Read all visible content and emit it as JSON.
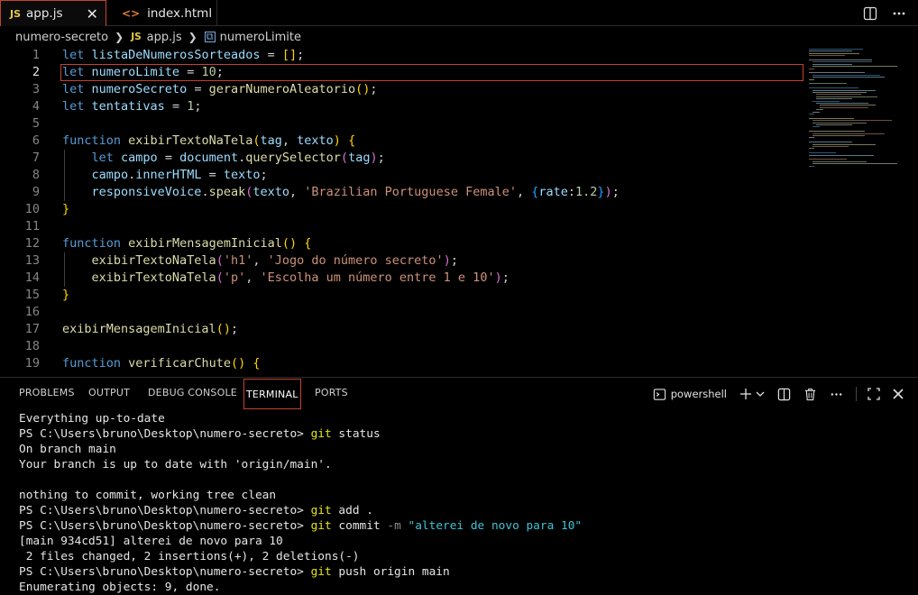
{
  "tabs": [
    {
      "badge": "JS",
      "label": "app.js",
      "close": "✕",
      "active": true
    },
    {
      "badge": "<>",
      "label": "index.html",
      "active": false
    }
  ],
  "breadcrumb": {
    "folder": "numero-secreto",
    "file_badge": "JS",
    "file": "app.js",
    "symbol": "numeroLimite"
  },
  "editor": {
    "current_line": 2,
    "line_numbers": [
      "1",
      "2",
      "3",
      "4",
      "5",
      "6",
      "7",
      "8",
      "9",
      "10",
      "11",
      "12",
      "13",
      "14",
      "15",
      "16",
      "17",
      "18",
      "19"
    ],
    "lines": [
      [
        {
          "t": "let",
          "c": "kw"
        },
        {
          "t": " "
        },
        {
          "t": "listaDeNumerosSorteados",
          "c": "var"
        },
        {
          "t": " = "
        },
        {
          "t": "[]",
          "c": "br1"
        },
        {
          "t": ";"
        }
      ],
      [
        {
          "t": "let",
          "c": "kw"
        },
        {
          "t": " "
        },
        {
          "t": "numeroLimite",
          "c": "var"
        },
        {
          "t": " = "
        },
        {
          "t": "10",
          "c": "num"
        },
        {
          "t": ";"
        }
      ],
      [
        {
          "t": "let",
          "c": "kw"
        },
        {
          "t": " "
        },
        {
          "t": "numeroSecreto",
          "c": "var"
        },
        {
          "t": " = "
        },
        {
          "t": "gerarNumeroAleatorio",
          "c": "fn"
        },
        {
          "t": "()",
          "c": "br1"
        },
        {
          "t": ";"
        }
      ],
      [
        {
          "t": "let",
          "c": "kw"
        },
        {
          "t": " "
        },
        {
          "t": "tentativas",
          "c": "var"
        },
        {
          "t": " = "
        },
        {
          "t": "1",
          "c": "num"
        },
        {
          "t": ";"
        }
      ],
      [],
      [
        {
          "t": "function",
          "c": "kw"
        },
        {
          "t": " "
        },
        {
          "t": "exibirTextoNaTela",
          "c": "fn"
        },
        {
          "t": "(",
          "c": "br1"
        },
        {
          "t": "tag",
          "c": "var"
        },
        {
          "t": ", "
        },
        {
          "t": "texto",
          "c": "var"
        },
        {
          "t": ")",
          "c": "br1"
        },
        {
          "t": " "
        },
        {
          "t": "{",
          "c": "br1"
        }
      ],
      [
        {
          "t": "    "
        },
        {
          "t": "let",
          "c": "kw"
        },
        {
          "t": " "
        },
        {
          "t": "campo",
          "c": "var"
        },
        {
          "t": " = "
        },
        {
          "t": "document",
          "c": "var"
        },
        {
          "t": "."
        },
        {
          "t": "querySelector",
          "c": "fn"
        },
        {
          "t": "(",
          "c": "br2"
        },
        {
          "t": "tag",
          "c": "var"
        },
        {
          "t": ")",
          "c": "br2"
        },
        {
          "t": ";"
        }
      ],
      [
        {
          "t": "    "
        },
        {
          "t": "campo",
          "c": "var"
        },
        {
          "t": "."
        },
        {
          "t": "innerHTML",
          "c": "var"
        },
        {
          "t": " = "
        },
        {
          "t": "texto",
          "c": "var"
        },
        {
          "t": ";"
        }
      ],
      [
        {
          "t": "    "
        },
        {
          "t": "responsiveVoice",
          "c": "var"
        },
        {
          "t": "."
        },
        {
          "t": "speak",
          "c": "fn"
        },
        {
          "t": "(",
          "c": "br2"
        },
        {
          "t": "texto",
          "c": "var"
        },
        {
          "t": ", "
        },
        {
          "t": "'Brazilian Portuguese Female'",
          "c": "str"
        },
        {
          "t": ", "
        },
        {
          "t": "{",
          "c": "br3"
        },
        {
          "t": "rate",
          "c": "var"
        },
        {
          "t": ":"
        },
        {
          "t": "1.2",
          "c": "num"
        },
        {
          "t": "}",
          "c": "br3"
        },
        {
          "t": ")",
          "c": "br2"
        },
        {
          "t": ";"
        }
      ],
      [
        {
          "t": "}",
          "c": "br1"
        }
      ],
      [],
      [
        {
          "t": "function",
          "c": "kw"
        },
        {
          "t": " "
        },
        {
          "t": "exibirMensagemInicial",
          "c": "fn"
        },
        {
          "t": "()",
          "c": "br1"
        },
        {
          "t": " "
        },
        {
          "t": "{",
          "c": "br1"
        }
      ],
      [
        {
          "t": "    "
        },
        {
          "t": "exibirTextoNaTela",
          "c": "fn"
        },
        {
          "t": "(",
          "c": "br2"
        },
        {
          "t": "'h1'",
          "c": "str"
        },
        {
          "t": ", "
        },
        {
          "t": "'Jogo do número secreto'",
          "c": "str"
        },
        {
          "t": ")",
          "c": "br2"
        },
        {
          "t": ";"
        }
      ],
      [
        {
          "t": "    "
        },
        {
          "t": "exibirTextoNaTela",
          "c": "fn"
        },
        {
          "t": "(",
          "c": "br2"
        },
        {
          "t": "'p'",
          "c": "str"
        },
        {
          "t": ", "
        },
        {
          "t": "'Escolha um número entre 1 e 10'",
          "c": "str"
        },
        {
          "t": ")",
          "c": "br2"
        },
        {
          "t": ";"
        }
      ],
      [
        {
          "t": "}",
          "c": "br1"
        }
      ],
      [],
      [
        {
          "t": "exibirMensagemInicial",
          "c": "fn"
        },
        {
          "t": "()",
          "c": "br1"
        },
        {
          "t": ";"
        }
      ],
      [],
      [
        {
          "t": "function",
          "c": "kw"
        },
        {
          "t": " "
        },
        {
          "t": "verificarChute",
          "c": "fn"
        },
        {
          "t": "()",
          "c": "br1"
        },
        {
          "t": " "
        },
        {
          "t": "{",
          "c": "br1"
        }
      ]
    ]
  },
  "panel": {
    "tabs": [
      "PROBLEMS",
      "OUTPUT",
      "DEBUG CONSOLE",
      "TERMINAL",
      "PORTS"
    ],
    "active_tab": "TERMINAL",
    "shell_name": "powershell",
    "terminal_lines": [
      [
        {
          "t": "Everything up-to-date"
        }
      ],
      [
        {
          "t": "PS C:\\Users\\bruno\\Desktop\\numero-secreto> "
        },
        {
          "t": "git",
          "c": "cmd"
        },
        {
          "t": " status"
        }
      ],
      [
        {
          "t": "On branch main"
        }
      ],
      [
        {
          "t": "Your branch is up to date with 'origin/main'."
        }
      ],
      [
        {
          "t": ""
        }
      ],
      [
        {
          "t": "nothing to commit, working tree clean"
        }
      ],
      [
        {
          "t": "PS C:\\Users\\bruno\\Desktop\\numero-secreto> "
        },
        {
          "t": "git",
          "c": "cmd"
        },
        {
          "t": " add ."
        }
      ],
      [
        {
          "t": "PS C:\\Users\\bruno\\Desktop\\numero-secreto> "
        },
        {
          "t": "git",
          "c": "cmd"
        },
        {
          "t": " commit "
        },
        {
          "t": "-m",
          "c": "flag"
        },
        {
          "t": " "
        },
        {
          "t": "\"alterei de novo para 10\"",
          "c": "tstr"
        }
      ],
      [
        {
          "t": "[main 934cd51] alterei de novo para 10"
        }
      ],
      [
        {
          "t": " 2 files changed, 2 insertions(+), 2 deletions(-)"
        }
      ],
      [
        {
          "t": "PS C:\\Users\\bruno\\Desktop\\numero-secreto> "
        },
        {
          "t": "git",
          "c": "cmd"
        },
        {
          "t": " push origin main"
        }
      ],
      [
        {
          "t": "Enumerating objects: 9, done."
        }
      ]
    ]
  },
  "icons": {
    "split_editor": "split-editor-icon",
    "more": "more-actions-icon",
    "terminal": "terminal-icon",
    "add": "plus-icon",
    "dropdown": "chevron-down-icon",
    "split_terminal": "split-terminal-icon",
    "trash": "trash-icon",
    "maximize": "maximize-panel-icon",
    "close": "close-icon"
  }
}
